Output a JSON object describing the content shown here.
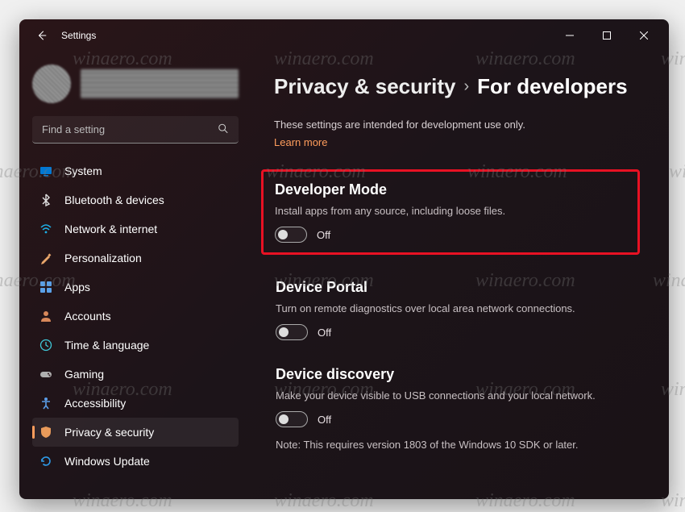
{
  "app": {
    "title": "Settings"
  },
  "search": {
    "placeholder": "Find a setting"
  },
  "sidebar": {
    "items": [
      {
        "key": "system",
        "label": "System",
        "icon_color": "#0078d4"
      },
      {
        "key": "bluetooth",
        "label": "Bluetooth & devices",
        "icon_color": "#e0e0e0"
      },
      {
        "key": "network",
        "label": "Network & internet",
        "icon_color": "#1db0e8"
      },
      {
        "key": "personalization",
        "label": "Personalization",
        "icon_color": "#e8a56a"
      },
      {
        "key": "apps",
        "label": "Apps",
        "icon_color": "#5aa0e8"
      },
      {
        "key": "accounts",
        "label": "Accounts",
        "icon_color": "#d8885a"
      },
      {
        "key": "time",
        "label": "Time & language",
        "icon_color": "#40c8d8"
      },
      {
        "key": "gaming",
        "label": "Gaming",
        "icon_color": "#b0b0b0"
      },
      {
        "key": "accessibility",
        "label": "Accessibility",
        "icon_color": "#5a9de8"
      },
      {
        "key": "privacy",
        "label": "Privacy & security",
        "icon_color": "#e89a5a",
        "active": true
      },
      {
        "key": "update",
        "label": "Windows Update",
        "icon_color": "#2e9ae8"
      }
    ]
  },
  "breadcrumb": {
    "parent": "Privacy & security",
    "separator": "›",
    "current": "For developers"
  },
  "intro": {
    "subtitle": "These settings are intended for development use only.",
    "learn_more": "Learn more"
  },
  "sections": [
    {
      "key": "dev-mode",
      "title": "Developer Mode",
      "description": "Install apps from any source, including loose files.",
      "toggle_state": "Off",
      "highlighted": true
    },
    {
      "key": "device-portal",
      "title": "Device Portal",
      "description": "Turn on remote diagnostics over local area network connections.",
      "toggle_state": "Off"
    },
    {
      "key": "device-discovery",
      "title": "Device discovery",
      "description": "Make your device visible to USB connections and your local network.",
      "toggle_state": "Off",
      "note": "Note: This requires version 1803 of the Windows 10 SDK or later."
    }
  ],
  "watermark": "winaero.com"
}
